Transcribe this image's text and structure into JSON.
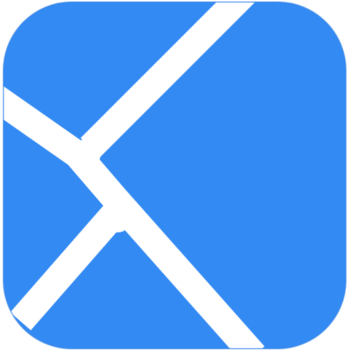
{
  "icon": {
    "name": "app-logo-icon",
    "colors": {
      "tile": "#338af3",
      "rim": "#2f7fe3",
      "stripes": "#ffffff"
    }
  }
}
